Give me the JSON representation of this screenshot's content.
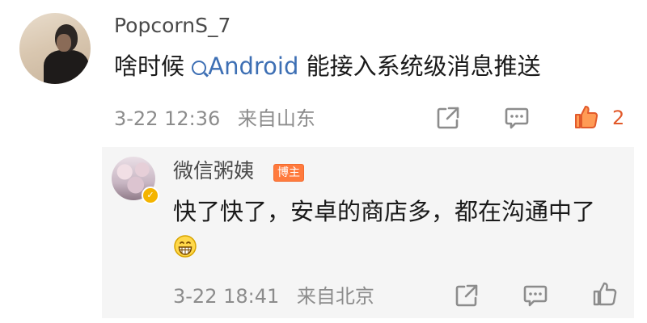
{
  "comment": {
    "username": "PopcornS_7",
    "text_before": "啥时候",
    "topic_link": "Android",
    "text_after": " 能接入系统级消息推送",
    "time": "3-22 12:36",
    "location": "来自山东",
    "like_count": "2",
    "like_color": "#e25a2b"
  },
  "reply": {
    "username": "微信粥姨",
    "author_badge": "博主",
    "text": "快了快了，安卓的商店多，都在沟通中了",
    "emoji": "grinning-face",
    "time": "3-22 18:41",
    "location": "来自北京"
  },
  "colors": {
    "link": "#3d6fb4",
    "meta": "#8c8c8c",
    "badge": "#ff7a3d",
    "reply_bg": "#f5f5f5"
  },
  "icons": [
    "share-icon",
    "comment-icon",
    "like-icon",
    "grinning-emoji-icon",
    "verified-icon",
    "topic-search-icon"
  ]
}
